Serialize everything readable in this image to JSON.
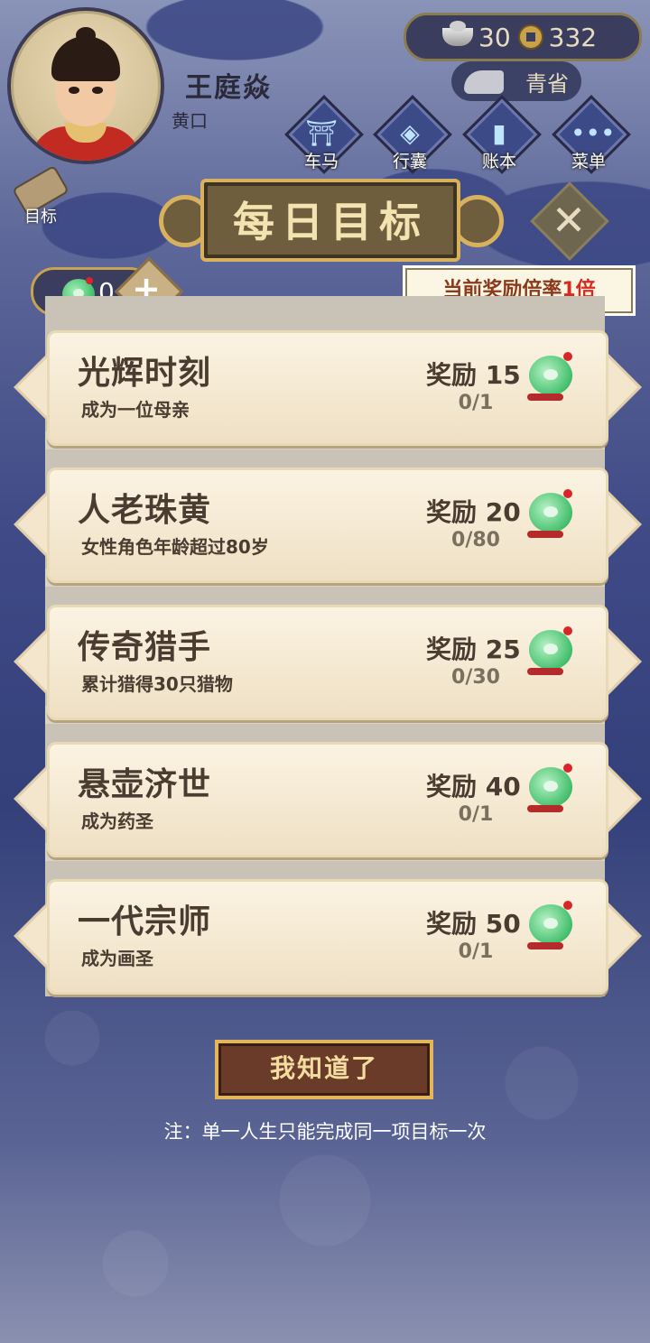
{
  "player": {
    "name": "王庭焱",
    "rank": "黄口"
  },
  "currency": {
    "silver": "30",
    "coins": "332"
  },
  "season": {
    "label": "青省"
  },
  "hud_buttons": [
    {
      "label": "车马",
      "icon": "carriage-icon"
    },
    {
      "label": "行囊",
      "icon": "bag-icon"
    },
    {
      "label": "账本",
      "icon": "ledger-icon"
    },
    {
      "label": "菜单",
      "icon": "menu-icon"
    }
  ],
  "goal_button": {
    "label": "目标",
    "icon": "scroll-icon"
  },
  "dialog": {
    "title": "每日目标",
    "jade_count": "0",
    "multiplier_prefix": "当前奖励倍率",
    "multiplier_value": "1倍",
    "confirm_label": "我知道了",
    "note": "注：单一人生只能完成同一项目标一次"
  },
  "goals": [
    {
      "title": "光辉时刻",
      "desc": "成为一位母亲",
      "reward": "奖励 15",
      "progress": "0/1"
    },
    {
      "title": "人老珠黄",
      "desc": "女性角色年龄超过80岁",
      "reward": "奖励 20",
      "progress": "0/80"
    },
    {
      "title": "传奇猎手",
      "desc": "累计猎得30只猎物",
      "reward": "奖励 25",
      "progress": "0/30"
    },
    {
      "title": "悬壶济世",
      "desc": "成为药圣",
      "reward": "奖励 40",
      "progress": "0/1"
    },
    {
      "title": "一代宗师",
      "desc": "成为画圣",
      "reward": "奖励 50",
      "progress": "0/1"
    }
  ],
  "colors": {
    "accent_gold": "#d7b15e",
    "highlight_red": "#d72a20",
    "jade_green": "#3fbf6a"
  }
}
